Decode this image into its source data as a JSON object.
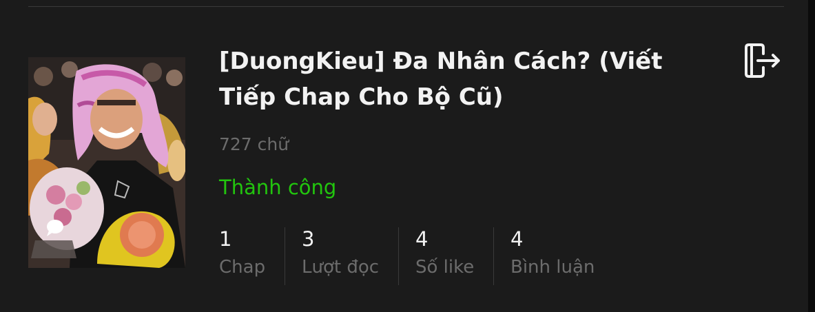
{
  "story": {
    "title": "[DuongKieu] Đa Nhân Cách? (Viết Tiếp Chap Cho Bộ Cũ)",
    "word_count": "727 chữ",
    "status": "Thành công",
    "status_color": "#22c50e"
  },
  "stats": [
    {
      "value": "1",
      "label": "Chap"
    },
    {
      "value": "3",
      "label": "Lượt đọc"
    },
    {
      "value": "4",
      "label": "Số like"
    },
    {
      "value": "4",
      "label": "Bình luận"
    }
  ],
  "icons": {
    "exit": "exit-icon",
    "cover_badge": "chat-bubble-icon"
  }
}
